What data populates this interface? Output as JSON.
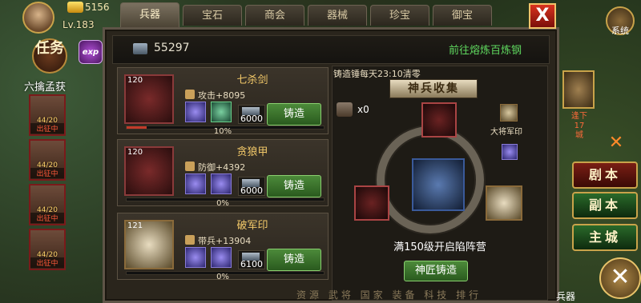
{
  "hud": {
    "gold_value": "5156",
    "level": "Lv.183",
    "quest_label": "任务",
    "exp_label": "exp",
    "quest_name": "六擒孟获",
    "heroes": [
      {
        "hp": "44/20",
        "status": "出征中"
      },
      {
        "hp": "44/20",
        "status": "出征中"
      },
      {
        "hp": "44/20",
        "status": "出征中"
      },
      {
        "hp": "44/20",
        "status": "出征中"
      }
    ]
  },
  "tabs": [
    "兵器",
    "宝石",
    "商会",
    "器械",
    "珍宝",
    "御宝"
  ],
  "active_tab": 0,
  "close_label": "X",
  "iron": {
    "value": "55297",
    "goto_link": "前往熔炼百炼钢"
  },
  "items": [
    {
      "level": "120",
      "name": "七杀剑",
      "stat": "攻击+8095",
      "cost": "6000",
      "forge": "铸造",
      "progress": 0.1,
      "percent": "10%"
    },
    {
      "level": "120",
      "name": "贪狼甲",
      "stat": "防御+4392",
      "cost": "6000",
      "forge": "铸造",
      "progress": 0,
      "percent": "0%"
    },
    {
      "level": "121",
      "name": "破军印",
      "stat": "带兵+13904",
      "cost": "6100",
      "forge": "铸造",
      "progress": 0,
      "percent": "0%"
    }
  ],
  "collection": {
    "reset_note": "铸造锤每天23:10清零",
    "title": "神兵收集",
    "hammer_count": "x0",
    "seal_label": "大将军印",
    "unlock_text": "满150级开启陷阵营",
    "camp_button": "神匠铸造"
  },
  "right_hud": {
    "system": "系统",
    "npc_label": "逢下17城",
    "buttons": [
      "剧本",
      "副本",
      "主城"
    ],
    "bottom_label": "兵器"
  },
  "bottom_nav": "资源 武将 国家 装备 科技 排行"
}
